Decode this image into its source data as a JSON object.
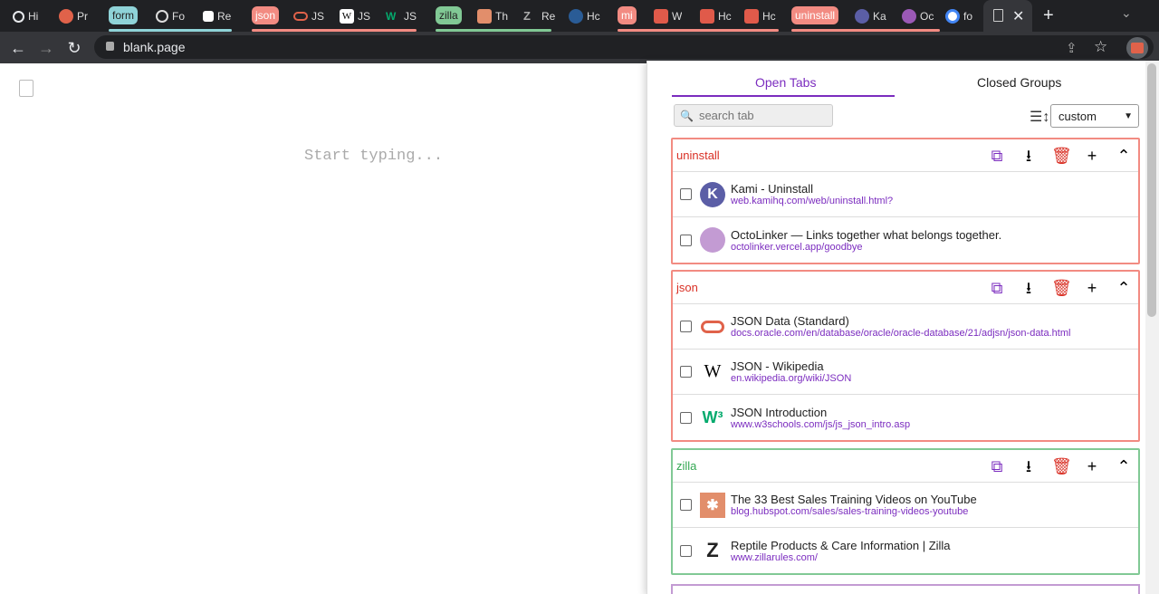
{
  "browser": {
    "tabs": [
      {
        "label": "Hi",
        "icon": "history-icon",
        "color": "#e8eaed"
      },
      {
        "label": "Pr",
        "icon": "red-circle-icon",
        "color": "#e0624a"
      },
      {
        "label": "Fo",
        "icon": "github-icon",
        "color": "#ddd"
      },
      {
        "label": "Re",
        "icon": "note-icon",
        "color": "#fff"
      },
      {
        "label": "JS",
        "icon": "oracle-icon",
        "color": "#e0624a"
      },
      {
        "label": "JS",
        "icon": "wikipedia-icon",
        "color": "#fff"
      },
      {
        "label": "JS",
        "icon": "w3-icon",
        "color": "#04aa6d"
      },
      {
        "label": "Th",
        "icon": "hubspot-icon",
        "color": "#e28e6b"
      },
      {
        "label": "Re",
        "icon": "zilla-icon",
        "color": "#aaa"
      },
      {
        "label": "Hc",
        "icon": "arrow-icon",
        "color": "#4d8fdd"
      },
      {
        "label": "W",
        "icon": "mi-icon",
        "color": "#e05a4a"
      },
      {
        "label": "Hc",
        "icon": "mi-icon",
        "color": "#e05a4a"
      },
      {
        "label": "Hc",
        "icon": "mi-icon",
        "color": "#e05a4a"
      },
      {
        "label": "Ka",
        "icon": "kami-icon",
        "color": "#5b5ea6"
      },
      {
        "label": "Oc",
        "icon": "octolinker-icon",
        "color": "#9b59b6"
      },
      {
        "label": "fo",
        "icon": "google-icon",
        "color": "#4285f4"
      }
    ],
    "groups": [
      {
        "label": "form",
        "color": "#8fd3d8"
      },
      {
        "label": "json",
        "color": "#f28b82"
      },
      {
        "label": "zilla",
        "color": "#81c995"
      },
      {
        "label": "mi",
        "color": "#f28b82"
      },
      {
        "label": "uninstall",
        "color": "#f28b82"
      }
    ],
    "url": "blank.page"
  },
  "page": {
    "placeholder": "Start typing..."
  },
  "popup": {
    "tabs": [
      "Open Tabs",
      "Closed Groups"
    ],
    "search_placeholder": "search tab",
    "sort_value": "custom",
    "groups": [
      {
        "name": "uninstall",
        "color": "#f28b82",
        "name_color": "#d93025",
        "items": [
          {
            "title": "Kami - Uninstall",
            "url": "web.kamihq.com/web/uninstall.html?",
            "icon": "kami-icon"
          },
          {
            "title": "OctoLinker — Links together what belongs together.",
            "url": "octolinker.vercel.app/goodbye",
            "icon": "octolinker-icon"
          }
        ]
      },
      {
        "name": "json",
        "color": "#f28b82",
        "name_color": "#d93025",
        "items": [
          {
            "title": "JSON Data (Standard)",
            "url": "docs.oracle.com/en/database/oracle/oracle-database/21/adjsn/json-data.html",
            "icon": "oracle-icon"
          },
          {
            "title": "JSON - Wikipedia",
            "url": "en.wikipedia.org/wiki/JSON",
            "icon": "wikipedia-icon"
          },
          {
            "title": "JSON Introduction",
            "url": "www.w3schools.com/js/js_json_intro.asp",
            "icon": "w3-icon"
          }
        ]
      },
      {
        "name": "zilla",
        "color": "#81c995",
        "name_color": "#34a853",
        "items": [
          {
            "title": "The 33 Best Sales Training Videos on YouTube",
            "url": "blog.hubspot.com/sales/sales-training-videos-youtube",
            "icon": "hubspot-icon"
          },
          {
            "title": "Reptile Products & Care Information | Zilla",
            "url": "www.zillarules.com/",
            "icon": "zilla-icon"
          }
        ]
      }
    ]
  }
}
